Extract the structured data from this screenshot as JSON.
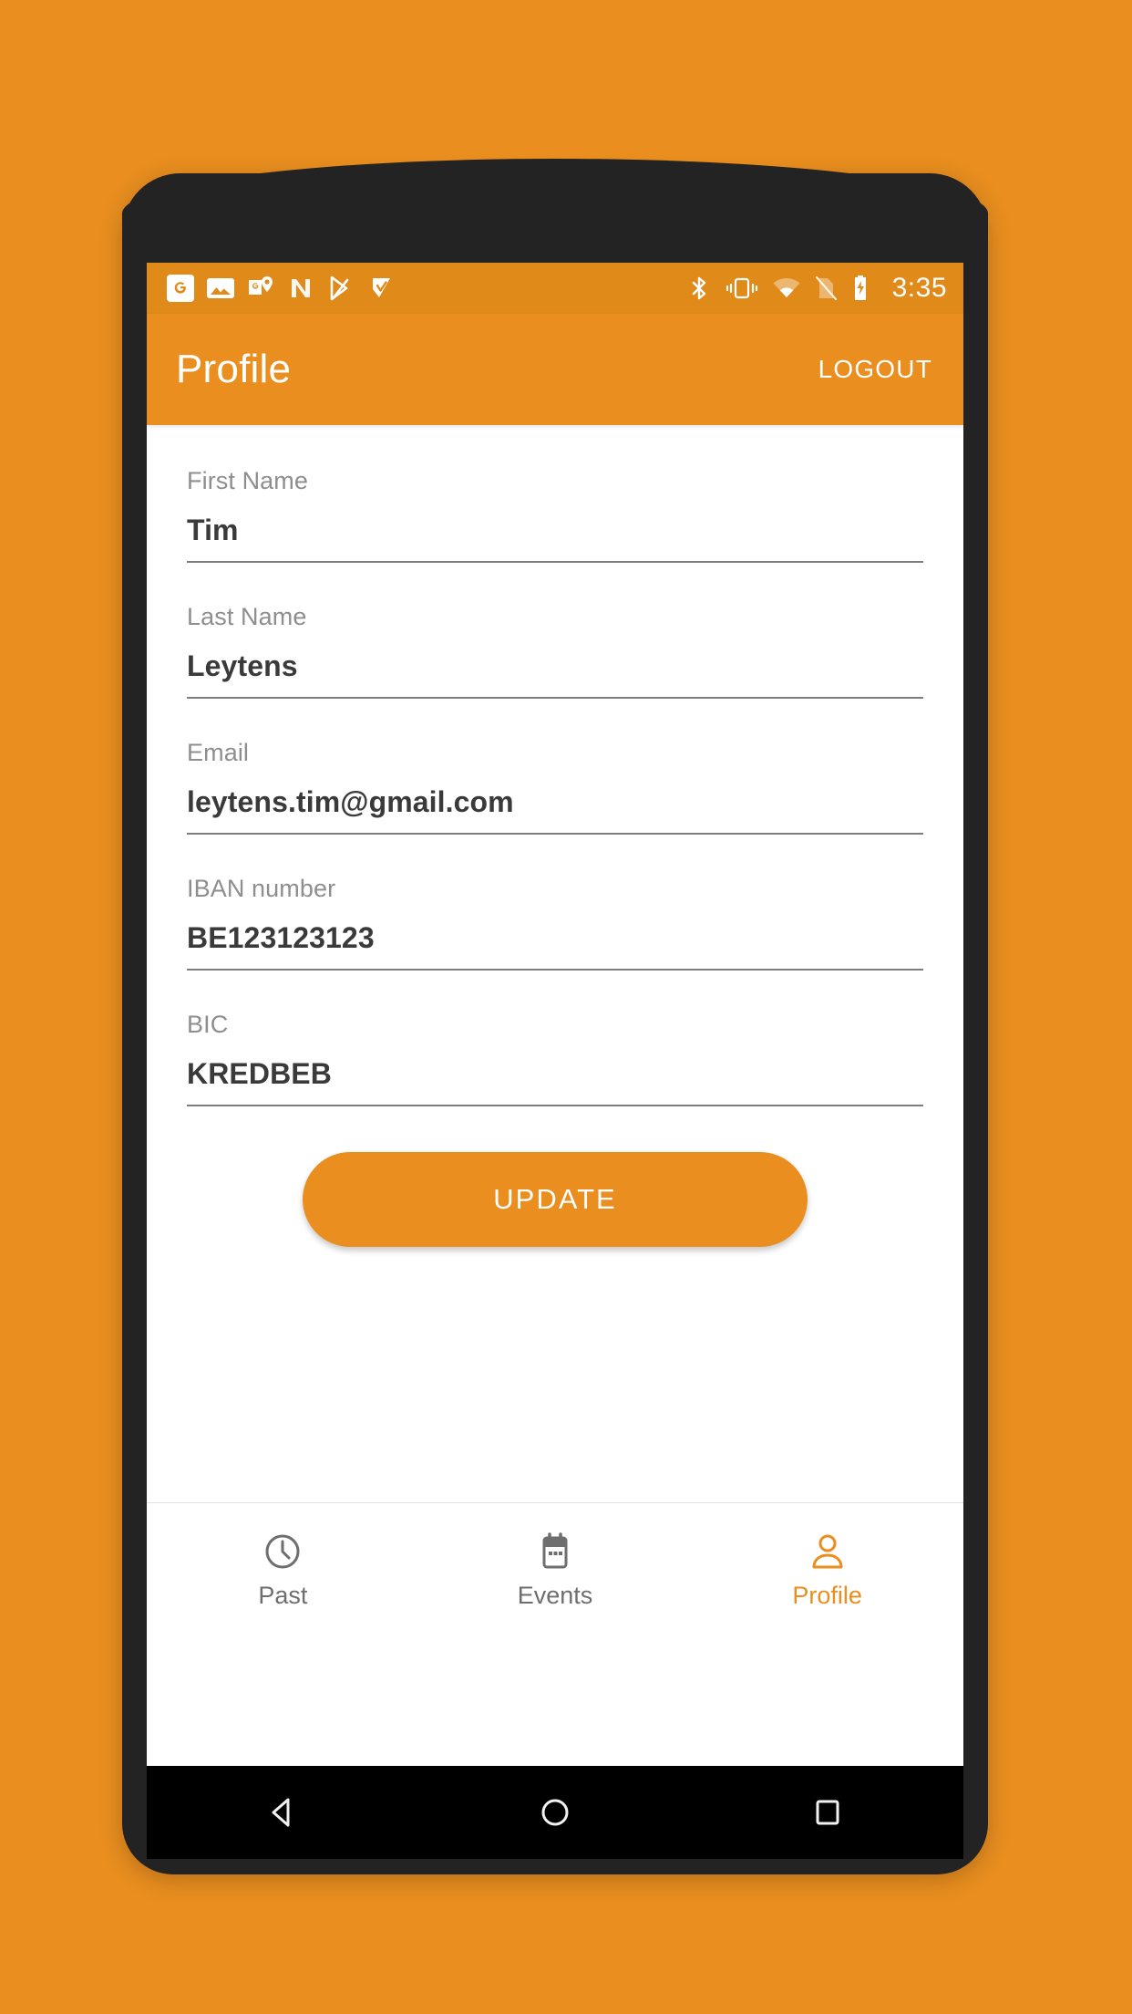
{
  "theme": {
    "brand_orange": "#E98E1F",
    "status_bar_orange": "#E08A19",
    "frame_dark": "#232323",
    "label_gray": "#8E8E8E",
    "value_dark": "#3A3A3A",
    "underline_gray": "#7D7D7D",
    "nav_inactive_gray": "#6E6E6E",
    "white": "#FFFFFF"
  },
  "status_bar": {
    "clock": "3:35",
    "notification_icons": [
      "google-icon",
      "photos-icon",
      "google-maps-icon",
      "android-n-icon",
      "play-store-icon",
      "play-checkmark-icon"
    ],
    "system_icons": [
      "bluetooth-icon",
      "vibrate-icon",
      "wifi-icon",
      "no-sim-icon",
      "battery-charging-icon"
    ]
  },
  "app_bar": {
    "title": "Profile",
    "logout_label": "LOGOUT"
  },
  "form": {
    "fields": [
      {
        "label": "First Name",
        "value": "Tim"
      },
      {
        "label": "Last Name",
        "value": "Leytens"
      },
      {
        "label": "Email",
        "value": "leytens.tim@gmail.com"
      },
      {
        "label": "IBAN number",
        "value": "BE123123123"
      },
      {
        "label": "BIC",
        "value": "KREDBEB"
      }
    ],
    "update_label": "UPDATE"
  },
  "bottom_nav": {
    "items": [
      {
        "label": "Past",
        "icon": "clock-icon",
        "active": false
      },
      {
        "label": "Events",
        "icon": "calendar-icon",
        "active": false
      },
      {
        "label": "Profile",
        "icon": "person-icon",
        "active": true
      }
    ]
  },
  "android_nav": {
    "buttons": [
      "back-icon",
      "home-icon",
      "recents-icon"
    ]
  }
}
